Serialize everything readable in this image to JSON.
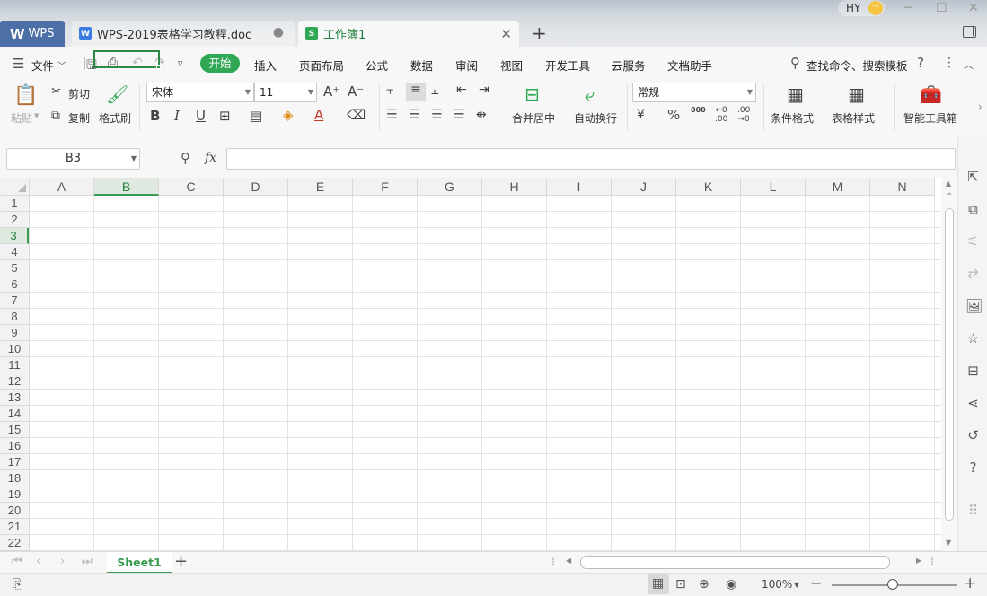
{
  "window": {
    "user_initials": "HY",
    "user_badge": "···",
    "tabs": [
      {
        "label": "WPS",
        "icon": "wps-logo-icon"
      },
      {
        "label": "WPS-2019表格学习教程.doc",
        "icon": "word-doc-icon"
      },
      {
        "label": "工作簿1",
        "icon": "sheet-icon",
        "active": true
      }
    ]
  },
  "menu": {
    "file_label": "文件",
    "items": [
      "开始",
      "插入",
      "页面布局",
      "公式",
      "数据",
      "审阅",
      "视图",
      "开发工具",
      "云服务",
      "文档助手"
    ],
    "search_label": "查找命令、搜索模板",
    "help": "?"
  },
  "ribbon": {
    "paste": "粘贴",
    "cut": "剪切",
    "copy": "复制",
    "format_painter": "格式刷",
    "font_name": "宋体",
    "font_size": "11",
    "bold": "B",
    "italic": "I",
    "underline": "U",
    "merge_center": "合并居中",
    "wrap_text": "自动换行",
    "number_format": "常规",
    "percent": "%",
    "thousands": "000",
    "conditional_format": "条件格式",
    "table_style": "表格样式",
    "smart_toolbox": "智能工具箱",
    "more": "›"
  },
  "formula_bar": {
    "name_box": "B3",
    "fx": "fx",
    "value": ""
  },
  "sheet": {
    "columns": [
      "A",
      "B",
      "C",
      "D",
      "E",
      "F",
      "G",
      "H",
      "I",
      "J",
      "K",
      "L",
      "M",
      "N"
    ],
    "rows": [
      "1",
      "2",
      "3",
      "4",
      "5",
      "6",
      "7",
      "8",
      "9",
      "10",
      "11",
      "12",
      "13",
      "14",
      "15",
      "16",
      "17",
      "18",
      "19",
      "20",
      "21",
      "22"
    ],
    "active_cell": "B3",
    "active_column": "B",
    "active_row": "3"
  },
  "sheet_tabs": {
    "tabs": [
      "Sheet1"
    ],
    "add": "+"
  },
  "status": {
    "zoom": "100%",
    "zoom_fraction": 0.5
  },
  "colors": {
    "accent": "#2fa754",
    "selection": "#2e8b47",
    "wps_tab": "#4b6fa6"
  }
}
